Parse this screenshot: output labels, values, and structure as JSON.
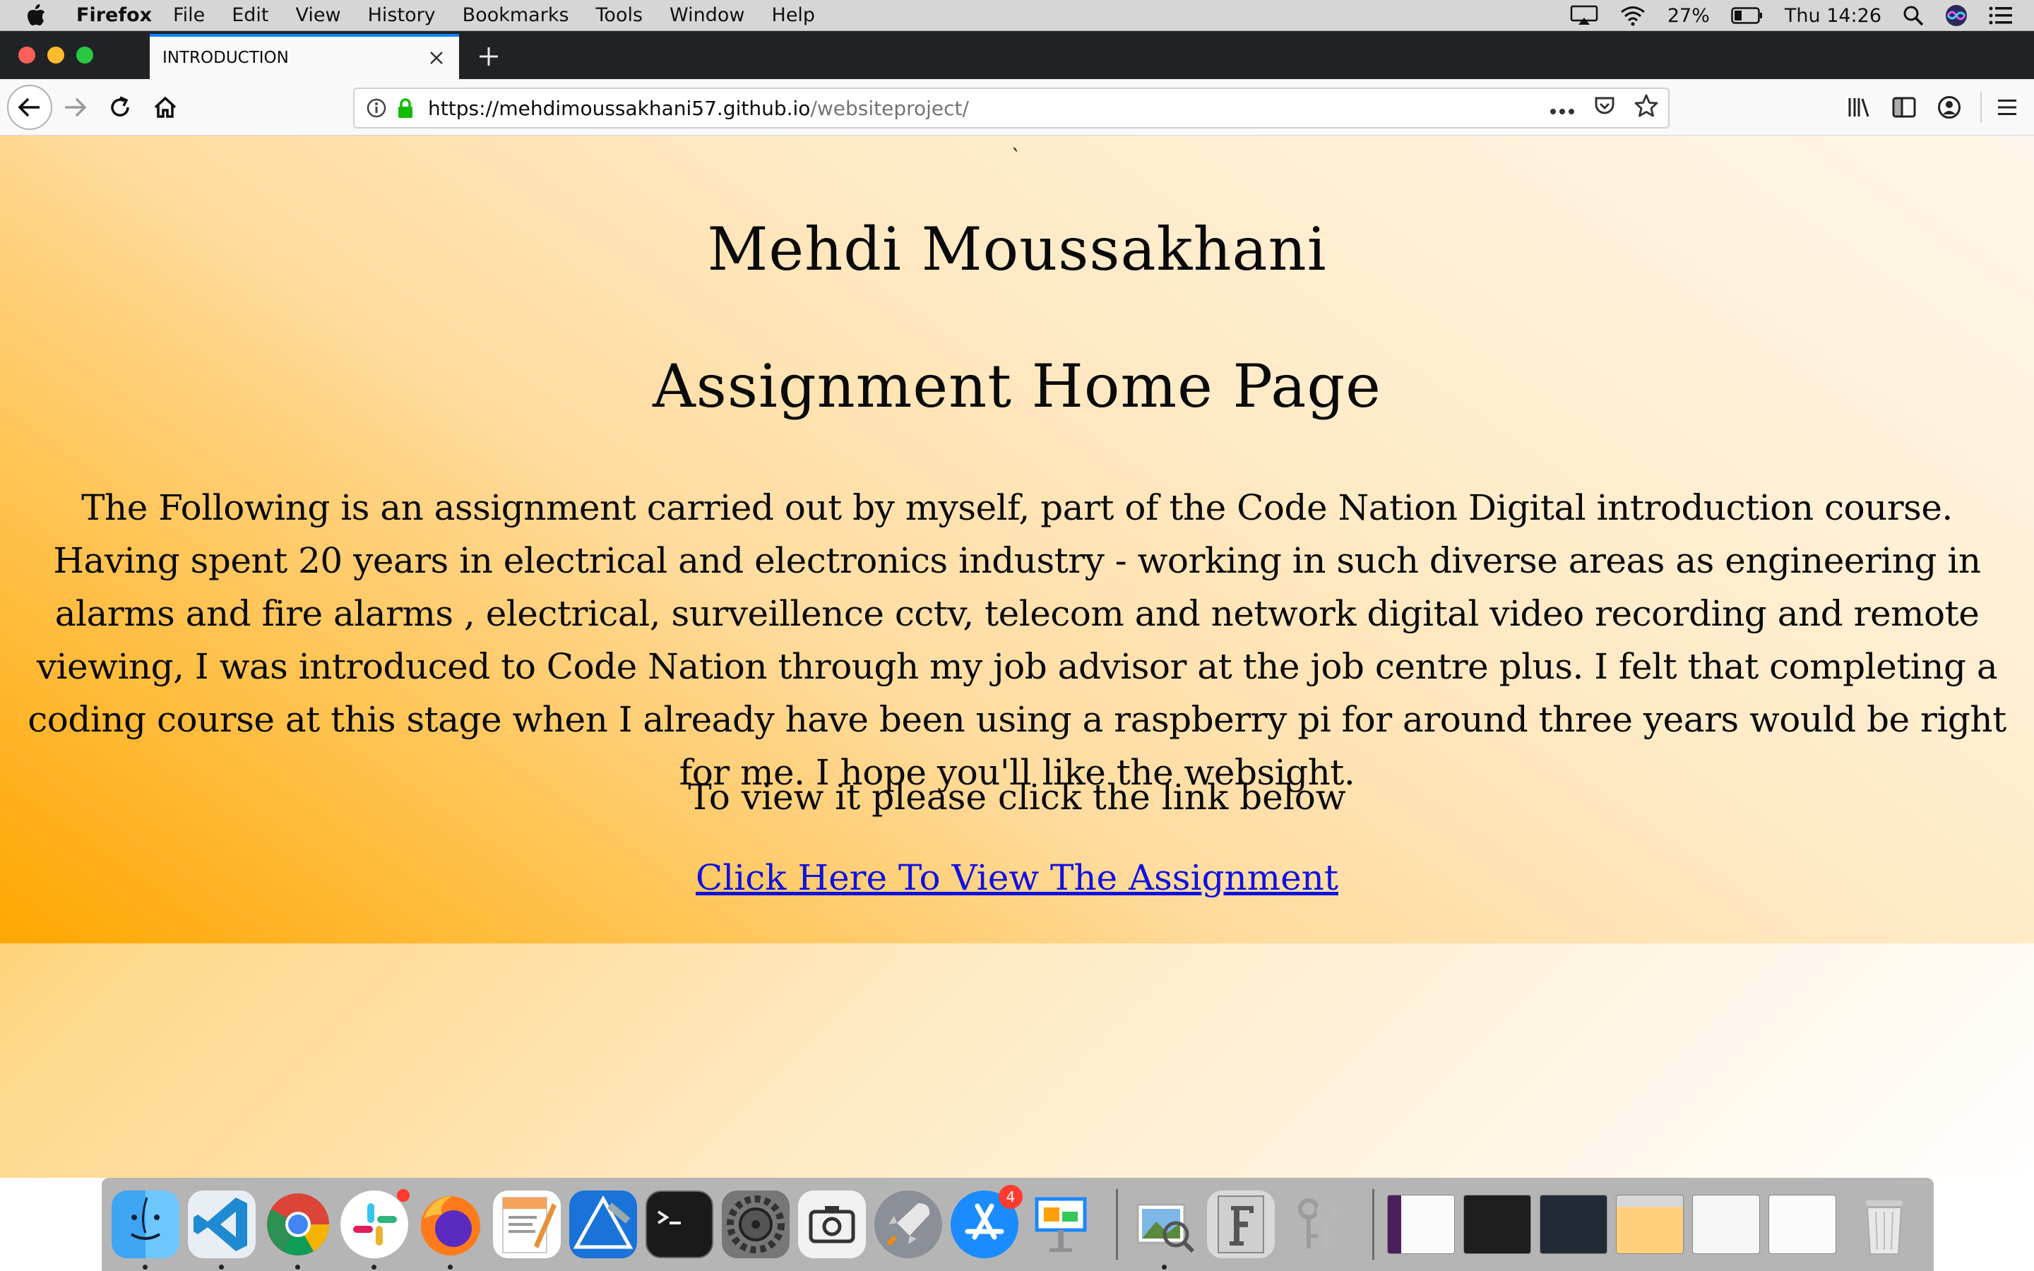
{
  "menubar": {
    "app_name": "Firefox",
    "items": [
      "File",
      "Edit",
      "View",
      "History",
      "Bookmarks",
      "Tools",
      "Window",
      "Help"
    ],
    "battery": "27%",
    "clock": "Thu 14:26"
  },
  "browser": {
    "tab_title": "INTRODUCTION",
    "url_host": "https://mehdimoussakhani57.github.io",
    "url_path": "/websiteproject/"
  },
  "page": {
    "tick_mark": "`",
    "name": "Mehdi Moussakhani",
    "heading": "Assignment Home Page",
    "intro": "The Following is an assignment carried out by myself, part of the Code Nation Digital introduction course. Having spent 20 years in electrical and electronics industry - working in such diverse areas as engineering in alarms and fire alarms , electrical, surveillence cctv, telecom and network digital video recording and remote viewing, I was introduced to Code Nation through my job advisor at the job centre plus. I felt that completing a coding course at this stage when I already have been using a raspberry pi for around three years would be right for me. I hope you'll like the websight.",
    "view_prompt": "To view it please click the link below",
    "link_text": "Click Here To View The Assignment"
  },
  "dock": {
    "slack_badge": "",
    "appstore_badge": "4",
    "apps": [
      "finder",
      "vscode",
      "chrome",
      "slack",
      "firefox",
      "pages",
      "xcode",
      "terminal",
      "system-preferences",
      "screenshot",
      "launchpad",
      "app-store",
      "keynote",
      "preview",
      "font-book",
      "keychain-access"
    ]
  },
  "colors": {
    "accent": "#0a84ff",
    "link": "#1010e0",
    "page_gradient_start": "#ffa200",
    "page_gradient_end": "#ffffff"
  }
}
